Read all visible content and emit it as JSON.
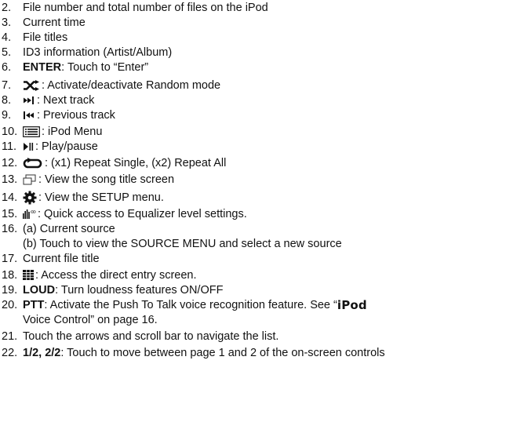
{
  "items": [
    {
      "num": "2.",
      "text": "File number and total number of files on the iPod"
    },
    {
      "num": "3.",
      "text": "Current time"
    },
    {
      "num": "4.",
      "text": "File titles"
    },
    {
      "num": "5.",
      "text": "ID3 information (Artist/Album)"
    },
    {
      "num": "6.",
      "bold": "ENTER",
      "text": ": Touch to “Enter”"
    },
    {
      "num": "7.",
      "icon": "shuffle-icon",
      "text": ": Activate/deactivate Random mode"
    },
    {
      "num": "8.",
      "icon": "next-track-icon",
      "text": ": Next track"
    },
    {
      "num": "9.",
      "icon": "previous-track-icon",
      "text": ": Previous track"
    },
    {
      "num": "10.",
      "icon": "ipod-menu-icon",
      "text": ": iPod Menu"
    },
    {
      "num": "11.",
      "icon": "play-pause-icon",
      "text": ": Play/pause"
    },
    {
      "num": "12.",
      "icon": "repeat-icon",
      "text": ": (x1) Repeat Single, (x2) Repeat All"
    },
    {
      "num": "13.",
      "icon": "song-title-screen-icon",
      "text": ": View the song title screen"
    },
    {
      "num": "14.",
      "icon": "setup-gear-icon",
      "text": ": View the SETUP menu."
    },
    {
      "num": "15.",
      "icon": "equalizer-icon",
      "text": ": Quick access to Equalizer level settings."
    },
    {
      "num": "16.",
      "text": "(a) Current source",
      "sub": "(b) Touch to view the SOURCE MENU and select a new source"
    },
    {
      "num": "17.",
      "text": "Current file title"
    },
    {
      "num": "18.",
      "icon": "direct-entry-grid-icon",
      "text": ": Access the direct entry screen."
    },
    {
      "num": "19.",
      "bold": "LOUD",
      "text": ": Turn loudness features ON/OFF"
    },
    {
      "num": "20.",
      "bold": "PTT",
      "text": ": Activate the Push To Talk voice recognition feature. See “",
      "brand": "iPod",
      "sub": "Voice Control” on page 16."
    },
    {
      "num": "21.",
      "text": "Touch the arrows and scroll bar to navigate the list."
    },
    {
      "num": "22.",
      "bold": "1/2, 2/2",
      "text": ": Touch to move between page 1 and 2 of the on-screen controls"
    }
  ]
}
